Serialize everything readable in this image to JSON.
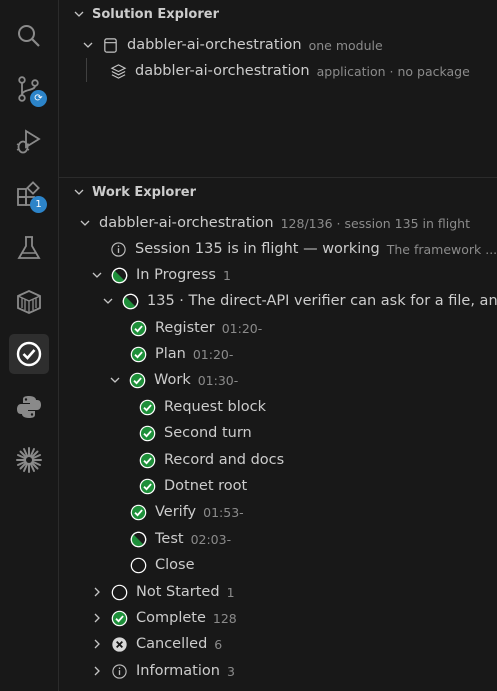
{
  "colors": {
    "accent_badge": "#2c84c9",
    "success": "#1e8f3a",
    "background": "#181818"
  },
  "activity_bar": [
    {
      "name": "search-icon",
      "badge": ""
    },
    {
      "name": "source-control-icon",
      "badge": ""
    },
    {
      "name": "run-debug-icon",
      "badge": ""
    },
    {
      "name": "extensions-icon",
      "badge": "1"
    },
    {
      "name": "testing-icon",
      "badge": ""
    },
    {
      "name": "containers-icon",
      "badge": ""
    },
    {
      "name": "work-check-icon",
      "badge": ""
    },
    {
      "name": "python-icon",
      "badge": ""
    },
    {
      "name": "sparkle-icon",
      "badge": ""
    }
  ],
  "solution_explorer": {
    "title": "Solution Explorer",
    "root": {
      "label": "dabbler-ai-orchestration",
      "description": "one module"
    },
    "child": {
      "label": "dabbler-ai-orchestration",
      "description": "application · no package"
    }
  },
  "work_explorer": {
    "title": "Work Explorer",
    "root": {
      "label": "dabbler-ai-orchestration",
      "description": "128/136 · session 135 in flight"
    },
    "info": {
      "label": "Session 135 is in flight — working",
      "description": "The framework ..."
    },
    "in_progress": {
      "label": "In Progress",
      "count": "1"
    },
    "session": {
      "label": "135 · The direct-API verifier can ask for a file, an..."
    },
    "steps": [
      {
        "label": "Register",
        "time": "01:20-",
        "status": "complete"
      },
      {
        "label": "Plan",
        "time": "01:20-",
        "status": "complete"
      },
      {
        "label": "Work",
        "time": "01:30-",
        "status": "complete"
      },
      {
        "label": "Request block",
        "time": "",
        "status": "complete"
      },
      {
        "label": "Second turn",
        "time": "",
        "status": "complete"
      },
      {
        "label": "Record and docs",
        "time": "",
        "status": "complete"
      },
      {
        "label": "Dotnet root",
        "time": "",
        "status": "complete"
      },
      {
        "label": "Verify",
        "time": "01:53-",
        "status": "complete"
      },
      {
        "label": "Test",
        "time": "02:03-",
        "status": "in-progress"
      },
      {
        "label": "Close",
        "time": "",
        "status": "not-started"
      }
    ],
    "groups": [
      {
        "label": "Not Started",
        "count": "1"
      },
      {
        "label": "Complete",
        "count": "128"
      },
      {
        "label": "Cancelled",
        "count": "6"
      },
      {
        "label": "Information",
        "count": "3"
      }
    ]
  }
}
